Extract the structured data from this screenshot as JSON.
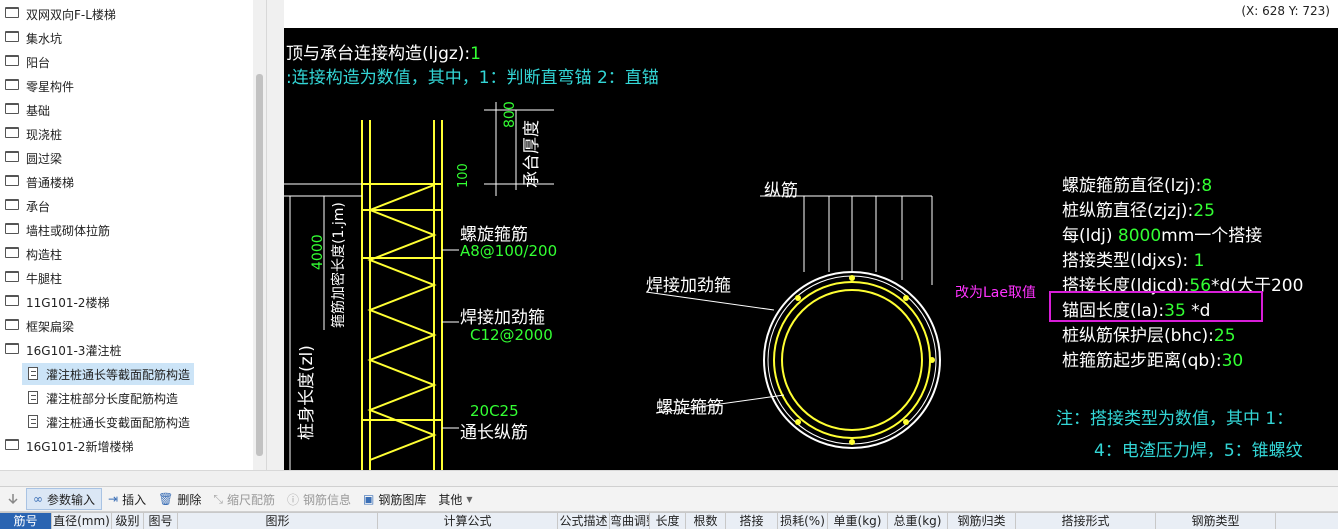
{
  "tree": {
    "items": [
      {
        "label": "双网双向F-L楼梯"
      },
      {
        "label": "集水坑"
      },
      {
        "label": "阳台"
      },
      {
        "label": "零星构件"
      },
      {
        "label": "基础"
      },
      {
        "label": "现浇桩"
      },
      {
        "label": "圆过梁"
      },
      {
        "label": "普通楼梯"
      },
      {
        "label": "承台"
      },
      {
        "label": "墙柱或砌体拉筋"
      },
      {
        "label": "构造柱"
      },
      {
        "label": "牛腿柱"
      },
      {
        "label": "11G101-2楼梯"
      },
      {
        "label": "框架扁梁"
      },
      {
        "label": "16G101-3灌注桩"
      },
      {
        "label": "灌注桩通长等截面配筋构造"
      },
      {
        "label": "灌注桩部分长度配筋构造"
      },
      {
        "label": "灌注桩通长变截面配筋构造"
      },
      {
        "label": "16G101-2新增楼梯"
      }
    ]
  },
  "canvas": {
    "coord": "(X: 628 Y: 723)",
    "line1_prefix": "顶与承台连接构造(ljgz):",
    "line1_value": "1",
    "line2": ":连接构造为数值，其中，1：判断直弯锚    2：直锚",
    "label_800": "800",
    "label_100": "100",
    "label_cap_thickness": "承台厚度",
    "label_4000": "4000",
    "label_dense_length": "箍筋加密长度(1.jm)",
    "label_pile_length": "桩身长度(zl)",
    "spiral_label": "螺旋箍筋",
    "spiral_value": "A8@100/200",
    "weld_label": "焊接加劲箍",
    "weld_value": "C12@2000",
    "long_value": "20C25",
    "long_label": "通长纵筋",
    "section_long": "纵筋",
    "section_weld": "焊接加劲箍",
    "section_spiral": "螺旋箍筋",
    "params": [
      {
        "label": "螺旋箍筋直径(lzj):",
        "value": "8",
        "suffix": ""
      },
      {
        "label": "桩纵筋直径(zjzj):",
        "value": "25",
        "suffix": ""
      },
      {
        "label": "每(ldj) ",
        "value": "8000",
        "suffix": "mm一个搭接"
      },
      {
        "label": "搭接类型(ldjxs): ",
        "value": "1",
        "suffix": ""
      },
      {
        "label": "搭接长度(ldjcd):",
        "value": "56",
        "suffix": "*d(大于200"
      },
      {
        "label": "锚固长度(la):",
        "value": "35",
        "suffix": " *d"
      },
      {
        "label": "桩纵筋保护层(bhc):",
        "value": "25",
        "suffix": ""
      },
      {
        "label": "桩箍筋起步距离(qb):",
        "value": "30",
        "suffix": ""
      }
    ],
    "annotation": "改为Lae取值",
    "note1": "注：搭接类型为数值，其中 1：",
    "note2": "4：电渣压力焊，5：锥螺纹"
  },
  "toolbar": {
    "items": [
      {
        "label": "参数输入",
        "active": true,
        "disabled": false,
        "icon": "param-icon"
      },
      {
        "label": "插入",
        "active": false,
        "disabled": false,
        "icon": "insert-icon"
      },
      {
        "label": "删除",
        "active": false,
        "disabled": false,
        "icon": "delete-icon"
      },
      {
        "label": "缩尺配筋",
        "active": false,
        "disabled": true,
        "icon": "scale-icon"
      },
      {
        "label": "钢筋信息",
        "active": false,
        "disabled": true,
        "icon": "info-icon"
      },
      {
        "label": "钢筋图库",
        "active": false,
        "disabled": false,
        "icon": "library-icon"
      },
      {
        "label": "其他",
        "active": false,
        "disabled": false,
        "icon": "other-icon"
      }
    ]
  },
  "table": {
    "headers": [
      "筋号",
      "直径(mm)",
      "级别",
      "图号",
      "图形",
      "计算公式",
      "公式描述",
      "弯曲调整",
      "长度",
      "根数",
      "搭接",
      "损耗(%)",
      "单重(kg)",
      "总重(kg)",
      "钢筋归类",
      "搭接形式",
      "钢筋类型"
    ]
  }
}
